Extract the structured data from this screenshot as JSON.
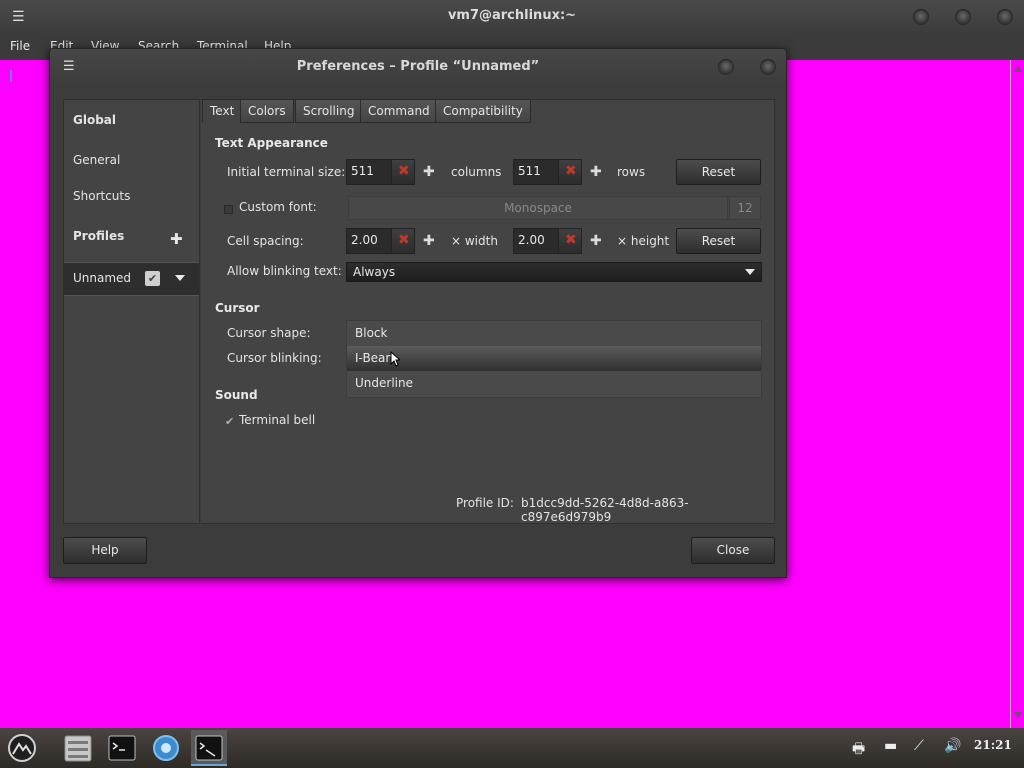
{
  "terminal": {
    "title": "vm7@archlinux:~",
    "menu": [
      "File",
      "Edit",
      "View",
      "Search",
      "Terminal",
      "Help"
    ],
    "background_color": "#ff00ff"
  },
  "dialog": {
    "title": "Preferences – Profile “Unnamed”",
    "sidebar": {
      "global_label": "Global",
      "general_label": "General",
      "shortcuts_label": "Shortcuts",
      "profiles_label": "Profiles",
      "profile_name": "Unnamed"
    },
    "tabs": [
      {
        "label": "Text",
        "active": true
      },
      {
        "label": "Colors"
      },
      {
        "label": "Scrolling"
      },
      {
        "label": "Command"
      },
      {
        "label": "Compatibility"
      }
    ],
    "text_appearance": {
      "heading": "Text Appearance",
      "initial_size_label": "Initial terminal size:",
      "columns_value": "511",
      "columns_label": "columns",
      "rows_value": "511",
      "rows_label": "rows",
      "reset_label": "Reset",
      "custom_font_label": "Custom font:",
      "font_name": "Monospace",
      "font_size": "12",
      "cell_spacing_label": "Cell spacing:",
      "width_value": "2.00",
      "width_label": "× width",
      "height_value": "2.00",
      "height_label": "× height",
      "reset2_label": "Reset",
      "blinking_label": "Allow blinking text:",
      "blinking_value": "Always"
    },
    "cursor": {
      "heading": "Cursor",
      "shape_label": "Cursor shape:",
      "blinking_label": "Cursor blinking:",
      "shape_options": [
        "Block",
        "I-Beam",
        "Underline"
      ]
    },
    "sound": {
      "heading": "Sound",
      "bell_label": "Terminal bell",
      "bell_checked": true
    },
    "profile_id_label": "Profile ID:",
    "profile_id_value": "b1dcc9dd-5262-4d8d-a863-c897e6d979b9",
    "help_label": "Help",
    "close_label": "Close"
  },
  "taskbar": {
    "apps": [
      "launcher-icon",
      "file-manager-icon",
      "terminal-icon",
      "browser-icon",
      "terminal-window-icon"
    ],
    "tray": [
      "printer-icon",
      "keyboard-icon",
      "network-icon",
      "volume-icon"
    ],
    "clock": "21:21"
  }
}
